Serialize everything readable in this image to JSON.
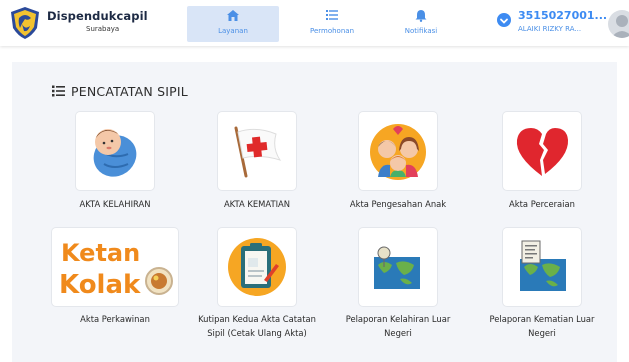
{
  "header": {
    "brand": "Dispendukcapil",
    "brand_sub": "Surabaya",
    "nav": [
      {
        "label": "Layanan",
        "icon": "home-icon",
        "active": true
      },
      {
        "label": "Permohonan",
        "icon": "list-icon",
        "active": false
      },
      {
        "label": "Notifikasi",
        "icon": "bell-icon",
        "active": false
      }
    ],
    "user_id": "3515027001...",
    "user_name": "ALAIKI RIZKY RA...",
    "accent": "#3d8bf2"
  },
  "section": {
    "title": "PENCATATAN SIPIL",
    "icon": "list-icon"
  },
  "items": [
    {
      "label": "AKTA KELAHIRAN",
      "icon": "baby-icon"
    },
    {
      "label": "AKTA KEMATIAN",
      "icon": "red-cross-flag-icon"
    },
    {
      "label": "Akta Pengesahan Anak",
      "icon": "family-icon"
    },
    {
      "label": "Akta Perceraian",
      "icon": "broken-heart-icon"
    },
    {
      "label": "Akta Perkawinan",
      "icon": "ketan-kolak-logo"
    },
    {
      "label": "Kutipan Kedua Akta Catatan Sipil (Cetak Ulang Akta)",
      "icon": "document-clipboard-icon"
    },
    {
      "label": "Pelaporan Kelahiran Luar Negeri",
      "icon": "world-map-icon"
    },
    {
      "label": "Pelaporan Kematian Luar Negeri",
      "icon": "world-map-document-icon"
    }
  ]
}
